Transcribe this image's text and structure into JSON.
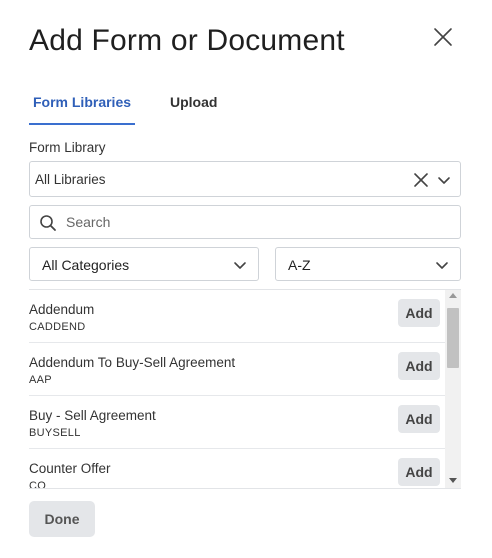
{
  "dialog": {
    "title": "Add Form or Document"
  },
  "tabs": [
    {
      "label": "Form Libraries",
      "active": true
    },
    {
      "label": "Upload",
      "active": false
    }
  ],
  "form_library": {
    "label": "Form Library",
    "selected": "All Libraries"
  },
  "search": {
    "placeholder": "Search",
    "value": ""
  },
  "filters": {
    "category": "All Categories",
    "sort": "A-Z"
  },
  "forms": [
    {
      "name": "Addendum",
      "code": "CADDEND",
      "action": "Add"
    },
    {
      "name": "Addendum To Buy-Sell Agreement",
      "code": "AAP",
      "action": "Add"
    },
    {
      "name": "Buy - Sell Agreement",
      "code": "BUYSELL",
      "action": "Add"
    },
    {
      "name": "Counter Offer",
      "code": "CO",
      "action": "Add"
    }
  ],
  "footer": {
    "done_label": "Done"
  },
  "colors": {
    "accent": "#2f5fb8",
    "button_bg": "#e4e6e9",
    "border": "#cfd3d8"
  }
}
